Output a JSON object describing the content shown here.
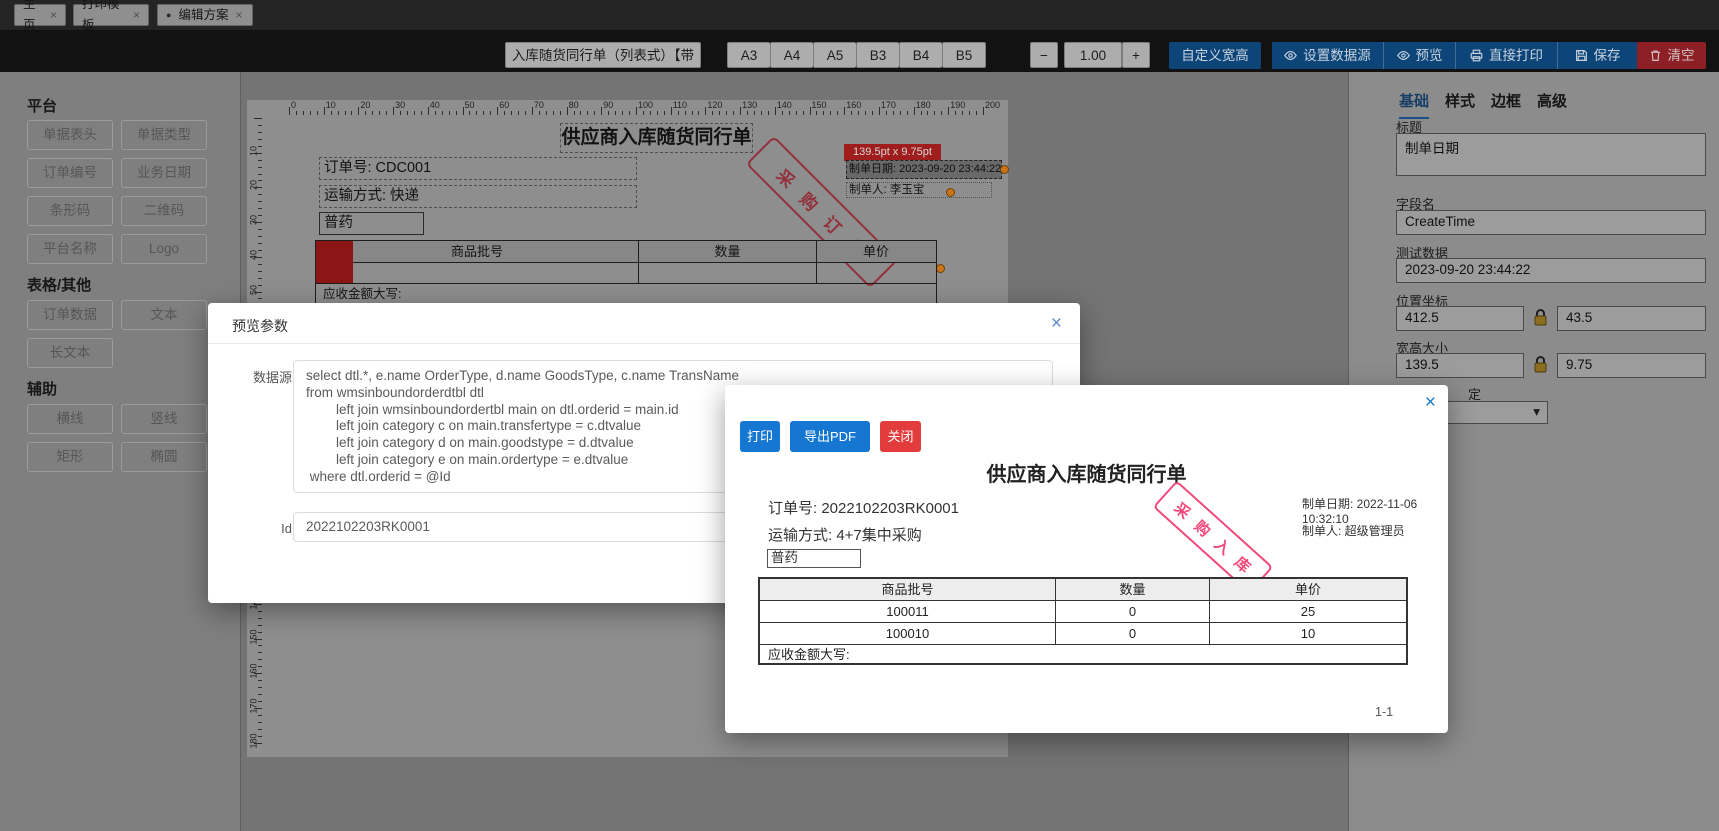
{
  "colors": {
    "accent_blue": "#1677d2",
    "danger_red": "#e23c3c",
    "stamp_pink": "#f2497b",
    "canvas_stamp_red": "#93313a",
    "handle_orange": "#c97417",
    "dim_blue_button": "#0e4579",
    "dim_red_button": "#8c2026",
    "active_tab_blue": "#1b4f86"
  },
  "icons": {
    "close_glyph": "×",
    "dropdown_glyph": "▾",
    "modified_dot": "●",
    "zoom_out_glyph": "−",
    "zoom_in_glyph": "+"
  },
  "tabbar": {
    "tabs": [
      {
        "label": "主页"
      },
      {
        "label": "打印模板"
      },
      {
        "label": "编辑方案",
        "dot": "●"
      }
    ]
  },
  "toolbar": {
    "template_name": "入库随货同行单（列表式）【带",
    "paper_sizes": [
      "A3",
      "A4",
      "A5",
      "B3",
      "B4",
      "B5"
    ],
    "zoom_value": "1.00",
    "custom_size": "自定义宽高",
    "set_datasource": "设置数据源",
    "preview": "预览",
    "direct_print": "直接打印",
    "save": "保存",
    "clear": "清空"
  },
  "sidebar": {
    "sections": [
      {
        "title": "平台",
        "items": [
          "单据表头",
          "单据类型",
          "订单编号",
          "业务日期",
          "条形码",
          "二维码",
          "平台名称",
          "Logo"
        ]
      },
      {
        "title": "表格/其他",
        "items": [
          "订单数据",
          "文本",
          "长文本"
        ]
      },
      {
        "title": "辅助",
        "items": [
          "横线",
          "竖线",
          "矩形",
          "椭圆"
        ]
      }
    ]
  },
  "canvas": {
    "ruler_h": {
      "from": 0,
      "to": 200,
      "step": 10
    },
    "ruler_v": {
      "from": 10,
      "to": 180,
      "step": 10
    },
    "doc": {
      "title": "供应商入库随货同行单",
      "order_no": "订单号: CDC001",
      "transport": "运输方式: 快递",
      "drug_type": "普药",
      "made_date": "制单日期: 2023-09-20 23:44:22",
      "maker": "制单人: 李玉宝",
      "stamp": "采购订单",
      "size_tooltip": "139.5pt x 9.75pt",
      "table_headers": [
        "商品批号",
        "数量",
        "单价"
      ],
      "table_footer": "应收金额大写:"
    }
  },
  "right_panel": {
    "tabs": [
      "基础",
      "样式",
      "边框",
      "高级"
    ],
    "active_tab": "基础",
    "title_label": "标题",
    "title_value": "制单日期",
    "field_label": "字段名",
    "field_value": "CreateTime",
    "test_label": "测试数据",
    "test_value": "2023-09-20 23:44:22",
    "pos_label": "位置坐标",
    "pos_x": "412.5",
    "pos_y": "43.5",
    "size_label": "宽高大小",
    "size_w": "139.5",
    "size_h": "9.75",
    "partial_label": "定"
  },
  "preview_params_modal": {
    "title": "预览参数",
    "datasource_label": "数据源",
    "sql": "select dtl.*, e.name OrderType, d.name GoodsType, c.name TransName\nfrom wmsinboundorderdtbl dtl\n        left join wmsinboundordertbl main on dtl.orderid = main.id\n        left join category c on main.transfertype = c.dtvalue\n        left join category d on main.goodstype = d.dtvalue\n        left join category e on main.ordertype = e.dtvalue\n where dtl.orderid = @Id",
    "id_label": "Id",
    "id_value": "2022102203RK0001"
  },
  "print_preview_modal": {
    "print": "打印",
    "export_pdf": "导出PDF",
    "close": "关闭",
    "doc": {
      "title": "供应商入库随货同行单",
      "order_no": "订单号: 2022102203RK0001",
      "made_date": "制单日期: 2022-11-06 10:32:10",
      "transport": "运输方式: 4+7集中采购",
      "maker": "制单人: 超级管理员",
      "drug_type": "普药",
      "stamp": "采购入库",
      "table": {
        "headers": [
          "商品批号",
          "数量",
          "单价"
        ],
        "rows": [
          [
            "100011",
            "0",
            "25"
          ],
          [
            "100010",
            "0",
            "10"
          ]
        ],
        "footer": "应收金额大写:"
      },
      "page": "1-1"
    }
  }
}
